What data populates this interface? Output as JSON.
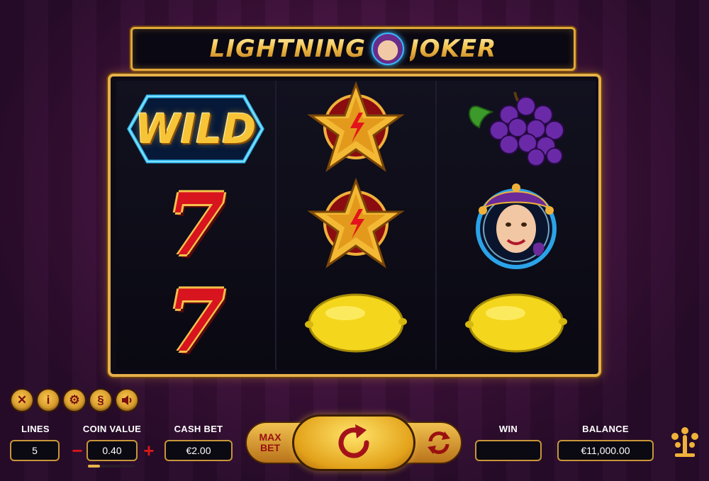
{
  "game": {
    "title": "LIGHTNING JOKER",
    "title_left": "LIGHTNING",
    "title_right": "JOKER"
  },
  "reels": [
    [
      "wild",
      "seven",
      "seven"
    ],
    [
      "star",
      "star",
      "lemon"
    ],
    [
      "grapes",
      "joker",
      "lemon"
    ]
  ],
  "symbols": {
    "wild_text": "WILD"
  },
  "top_icons": [
    {
      "name": "close-icon",
      "glyph": "✕"
    },
    {
      "name": "info-icon",
      "glyph": "i"
    },
    {
      "name": "gear-icon",
      "glyph": "⚙"
    },
    {
      "name": "paytable-icon",
      "glyph": "§"
    },
    {
      "name": "sound-icon",
      "glyph": "🔈"
    }
  ],
  "controls": {
    "lines_label": "LINES",
    "lines_value": "5",
    "coin_value_label": "COIN VALUE",
    "coin_value": "0.40",
    "coin_value_level": 0.25,
    "minus": "−",
    "plus": "+",
    "cash_bet_label": "CASH BET",
    "cash_bet_value": "€2.00",
    "max_bet_line1": "MAX",
    "max_bet_line2": "BET",
    "win_label": "WIN",
    "win_value": "",
    "balance_label": "BALANCE",
    "balance_value": "€11,000.00"
  },
  "colors": {
    "gold": "#e6b04a",
    "red": "#d8141e",
    "background": "#3a1238",
    "electric_blue": "#3ab8ff"
  }
}
